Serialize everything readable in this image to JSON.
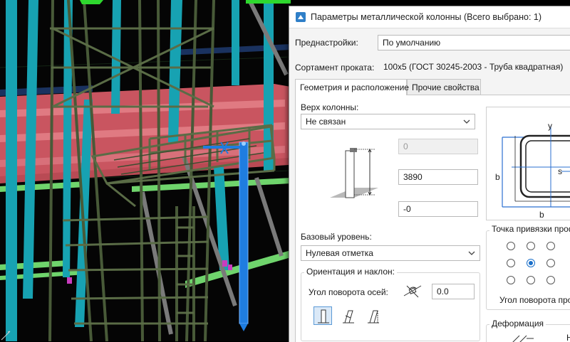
{
  "dialog": {
    "title": "Параметры металлической колонны (Всего выбрано: 1)",
    "presets": {
      "label": "Преднастройки:",
      "value": "По умолчанию"
    },
    "assortment": {
      "label": "Сортамент проката:",
      "value": "100x5 (ГОСТ 30245-2003 - Труба квадратная)"
    },
    "tabs": [
      {
        "label": "Геометрия и расположение",
        "active": true
      },
      {
        "label": "Прочие свойства",
        "active": false
      }
    ],
    "geometry": {
      "top_label": "Верх колонны:",
      "top_value": "Не связан",
      "offset_top": "0",
      "height": "3890",
      "offset_bottom": "-0",
      "base_level_label": "Базовый уровень:",
      "base_level_value": "Нулевая отметка"
    },
    "orientation": {
      "group_title": "Ориентация и наклон:",
      "angle_label": "Угол поворота осей:",
      "angle_value": "0.0"
    },
    "anchor": {
      "group_title": "Точка привязки профиля",
      "selected_index": 4,
      "angle_label": "Угол поворота проф"
    },
    "deformation": {
      "group_title": "Деформация",
      "cut_label": "Н"
    },
    "profile_section": {
      "label_b": "b",
      "label_y": "y",
      "label_s": "s"
    }
  },
  "colors": {
    "selection": "#1a6fc9",
    "viewport_bg": "#050505",
    "steel": "#4b5d3c",
    "beam_pink": "#d96a72",
    "column_teal": "#1aa3b3",
    "green_beam": "#7be07a"
  }
}
